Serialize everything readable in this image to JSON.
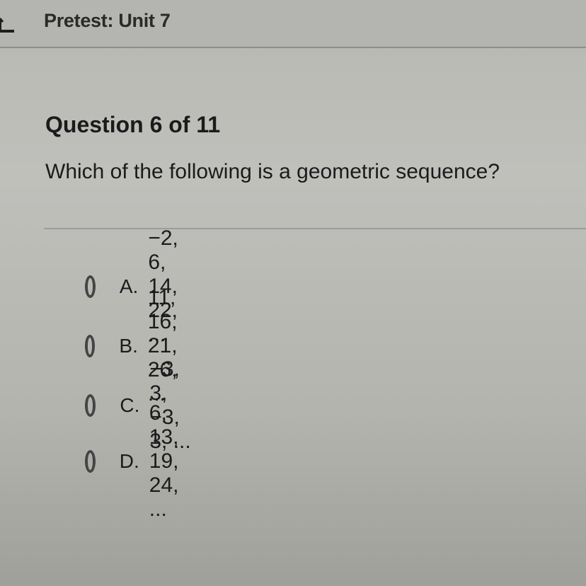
{
  "header": {
    "title": "Pretest: Unit 7",
    "back_icon": "back-arrow-icon"
  },
  "question": {
    "number_label": "Question 6 of 11",
    "prompt": "Which of the following is a geometric sequence?"
  },
  "options": [
    {
      "letter": "A.",
      "text": "−2, 6, 14, 22, ...",
      "selected": false
    },
    {
      "letter": "B.",
      "text": "11, 16, 21, 26, ...",
      "selected": false
    },
    {
      "letter": "C.",
      "text": "−3, 3, −3, 3, ...",
      "selected": false
    },
    {
      "letter": "D.",
      "text": "6, 13, 19, 24, ...",
      "selected": false
    }
  ]
}
